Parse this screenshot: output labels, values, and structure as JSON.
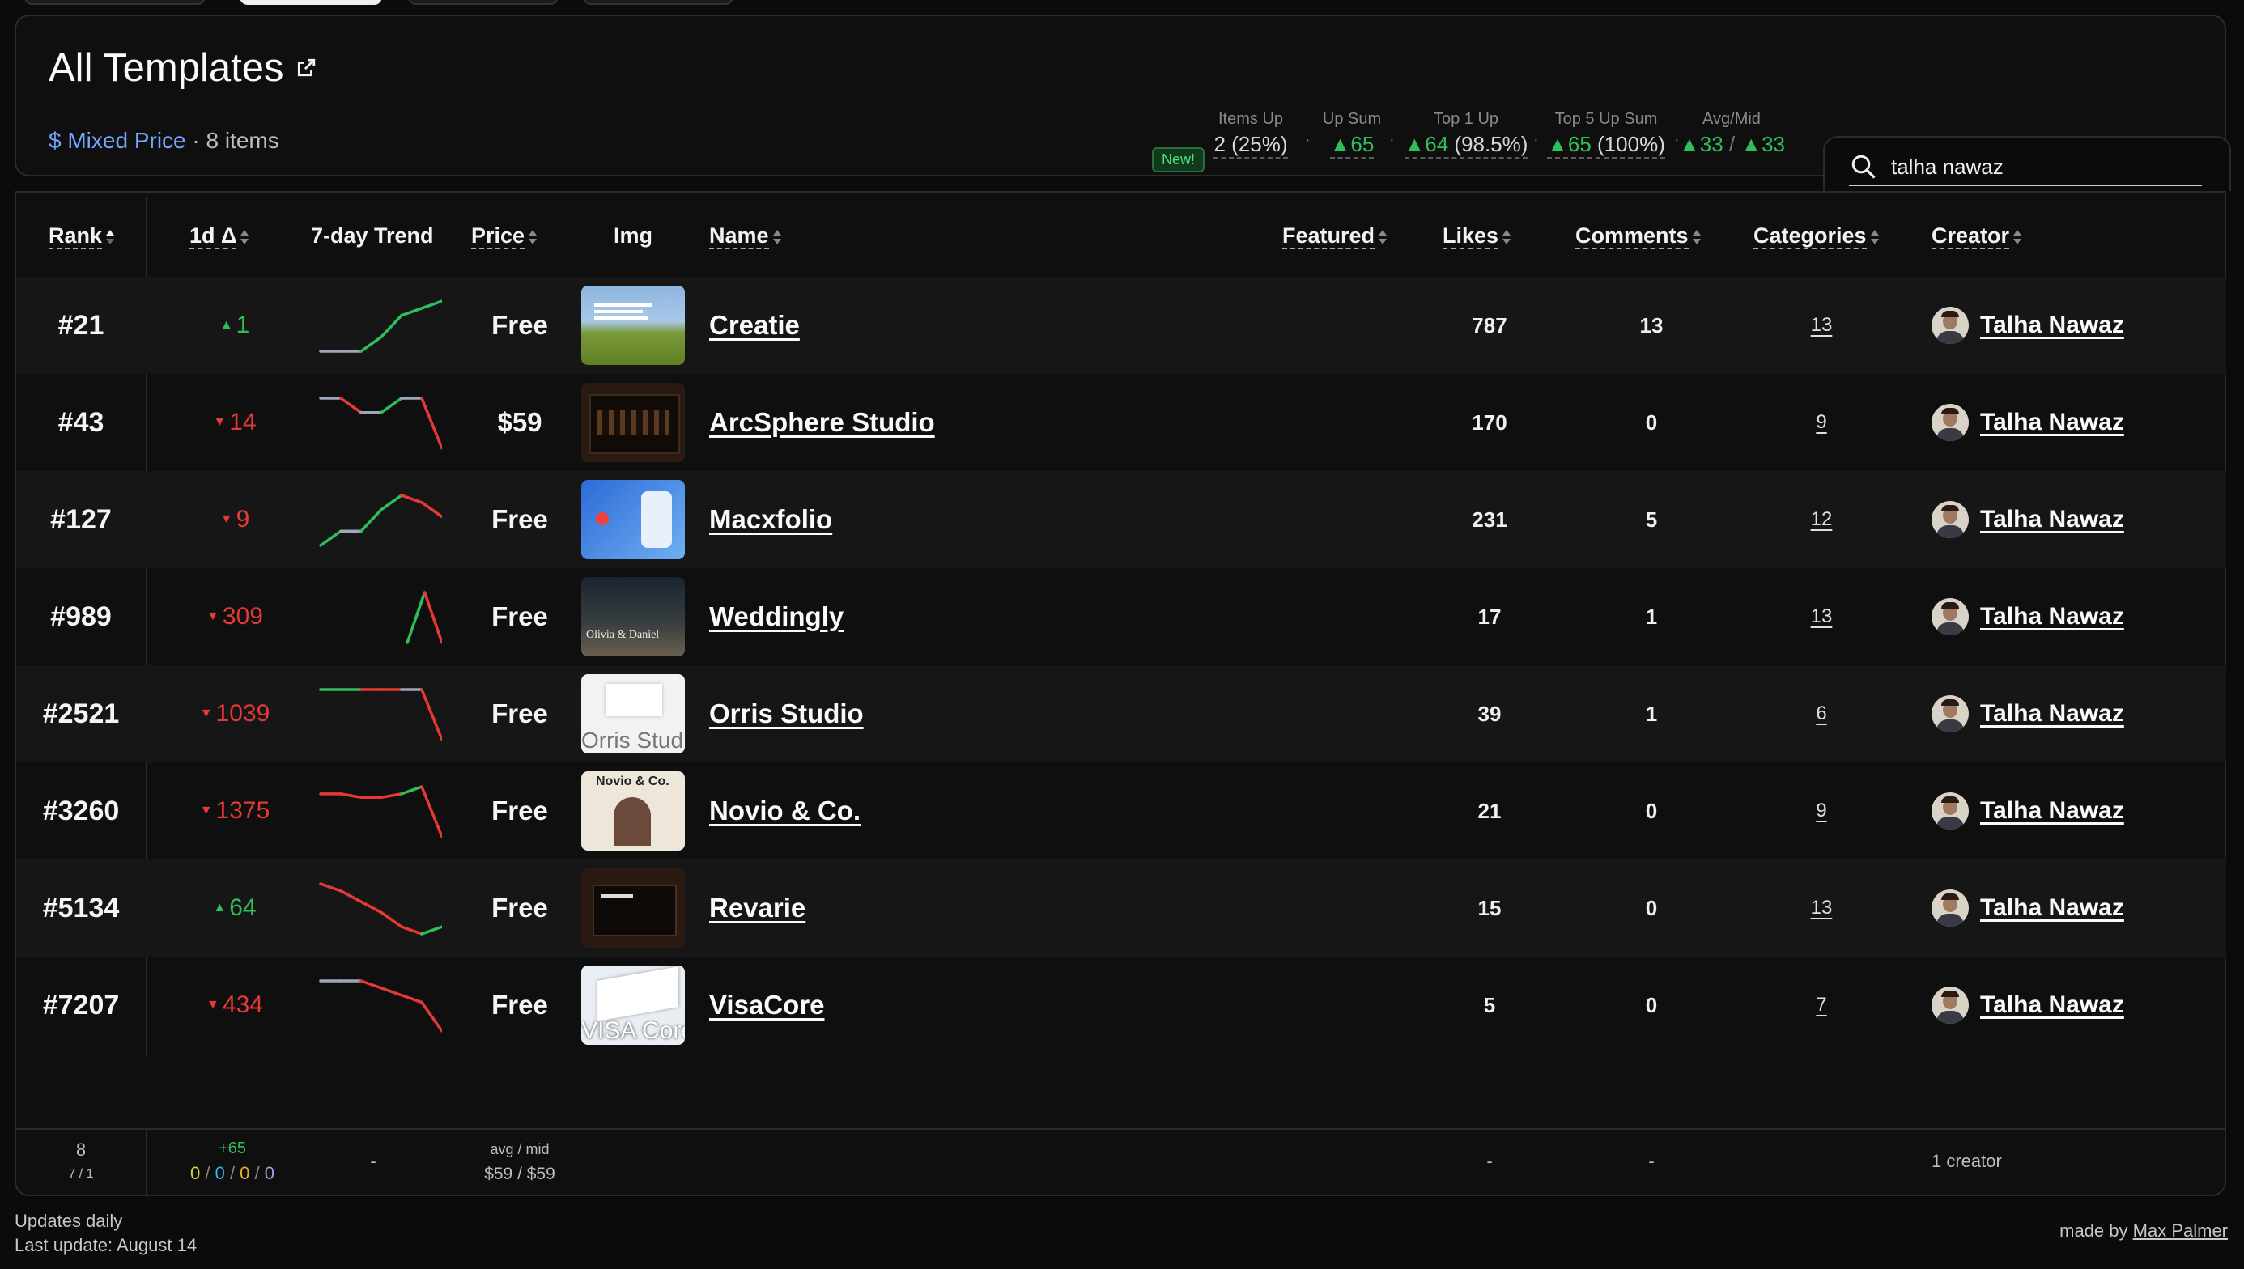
{
  "header": {
    "title": "All Templates",
    "price_mode_icon": "$",
    "price_mode_label": "Mixed Price",
    "item_count": "· 8 items"
  },
  "stats": {
    "new_badge": "New!",
    "items_up": {
      "label": "Items Up",
      "value": "2 (25%)"
    },
    "up_sum": {
      "label": "Up Sum",
      "value": "65"
    },
    "top1_up": {
      "label": "Top 1 Up",
      "value": "64",
      "extra": "(98.5%)"
    },
    "top5_up_sum": {
      "label": "Top 5 Up Sum",
      "value": "65",
      "extra": "(100%)"
    },
    "avg_mid": {
      "label": "Avg/Mid",
      "avg": "33",
      "mid": "33"
    }
  },
  "search": {
    "value": "talha nawaz",
    "icon": "search-icon"
  },
  "columns": {
    "rank": "Rank",
    "delta": "1d Δ",
    "trend": "7-day Trend",
    "price": "Price",
    "img": "Img",
    "name": "Name",
    "featured": "Featured",
    "likes": "Likes",
    "comments": "Comments",
    "categories": "Categories",
    "creator": "Creator"
  },
  "rows": [
    {
      "rank": "#21",
      "delta": "1",
      "dir": "up",
      "price": "Free",
      "name": "Creatie",
      "likes": "787",
      "comments": "13",
      "categories": "13",
      "creator": "Talha Nawaz",
      "trend": [
        1,
        1,
        1,
        3,
        6,
        7,
        8
      ],
      "trend_colors": [
        "#9ea7b8",
        "#9ea7b8",
        "#2fbf5a",
        "#2fbf5a",
        "#2fbf5a",
        "#2fbf5a"
      ]
    },
    {
      "rank": "#43",
      "delta": "14",
      "dir": "down",
      "price": "$59",
      "name": "ArcSphere Studio",
      "likes": "170",
      "comments": "0",
      "categories": "9",
      "creator": "Talha Nawaz",
      "trend": [
        8,
        8,
        6,
        6,
        8,
        8,
        1
      ],
      "trend_colors": [
        "#9ea7b8",
        "#e53935",
        "#9ea7b8",
        "#2fbf5a",
        "#9ea7b8",
        "#e53935"
      ]
    },
    {
      "rank": "#127",
      "delta": "9",
      "dir": "down",
      "price": "Free",
      "name": "Macxfolio",
      "likes": "231",
      "comments": "5",
      "categories": "12",
      "creator": "Talha Nawaz",
      "trend": [
        1,
        3,
        3,
        6,
        8,
        7,
        5
      ],
      "trend_colors": [
        "#2fbf5a",
        "#9ea7b8",
        "#2fbf5a",
        "#2fbf5a",
        "#e53935",
        "#e53935"
      ]
    },
    {
      "rank": "#989",
      "delta": "309",
      "dir": "down",
      "price": "Free",
      "name": "Weddingly",
      "likes": "17",
      "comments": "1",
      "categories": "13",
      "creator": "Talha Nawaz",
      "trend": [
        null,
        null,
        null,
        null,
        null,
        1,
        8,
        1
      ],
      "trend_colors": [
        "",
        "",
        "",
        "",
        "",
        "#2fbf5a",
        "#e53935"
      ]
    },
    {
      "rank": "#2521",
      "delta": "1039",
      "dir": "down",
      "price": "Free",
      "name": "Orris Studio",
      "likes": "39",
      "comments": "1",
      "categories": "6",
      "creator": "Talha Nawaz",
      "trend": [
        8,
        8,
        8,
        8,
        8,
        8,
        1
      ],
      "trend_colors": [
        "#2fbf5a",
        "#2fbf5a",
        "#e53935",
        "#e53935",
        "#9ea7b8",
        "#e53935"
      ]
    },
    {
      "rank": "#3260",
      "delta": "1375",
      "dir": "down",
      "price": "Free",
      "name": "Novio & Co.",
      "likes": "21",
      "comments": "0",
      "categories": "9",
      "creator": "Talha Nawaz",
      "trend": [
        7,
        7,
        6.5,
        6.5,
        7,
        8,
        1
      ],
      "trend_colors": [
        "#e53935",
        "#e53935",
        "#e53935",
        "#e53935",
        "#2fbf5a",
        "#e53935"
      ]
    },
    {
      "rank": "#5134",
      "delta": "64",
      "dir": "up",
      "price": "Free",
      "name": "Revarie",
      "likes": "15",
      "comments": "0",
      "categories": "13",
      "creator": "Talha Nawaz",
      "trend": [
        8,
        7,
        5.5,
        4,
        2,
        1,
        2
      ],
      "trend_colors": [
        "#e53935",
        "#e53935",
        "#e53935",
        "#e53935",
        "#e53935",
        "#2fbf5a"
      ]
    },
    {
      "rank": "#7207",
      "delta": "434",
      "dir": "down",
      "price": "Free",
      "name": "VisaCore",
      "likes": "5",
      "comments": "0",
      "categories": "7",
      "creator": "Talha Nawaz",
      "trend": [
        8,
        8,
        8,
        7,
        6,
        5,
        1
      ],
      "trend_colors": [
        "#9ea7b8",
        "#9ea7b8",
        "#e53935",
        "#e53935",
        "#e53935",
        "#e53935"
      ]
    }
  ],
  "footer": {
    "count": "8",
    "count_sub": "7 / 1",
    "delta_sum": "+65",
    "delta_breakdown": [
      "0",
      "0",
      "0",
      "0"
    ],
    "trend": "-",
    "price_label": "avg / mid",
    "price_value": "$59 / $59",
    "likes": "-",
    "comments": "-",
    "creators": "1 creator"
  },
  "page_footer": {
    "updates": "Updates daily",
    "last_update": "Last update: August 14",
    "made_by": "made by",
    "author": "Max Palmer"
  }
}
